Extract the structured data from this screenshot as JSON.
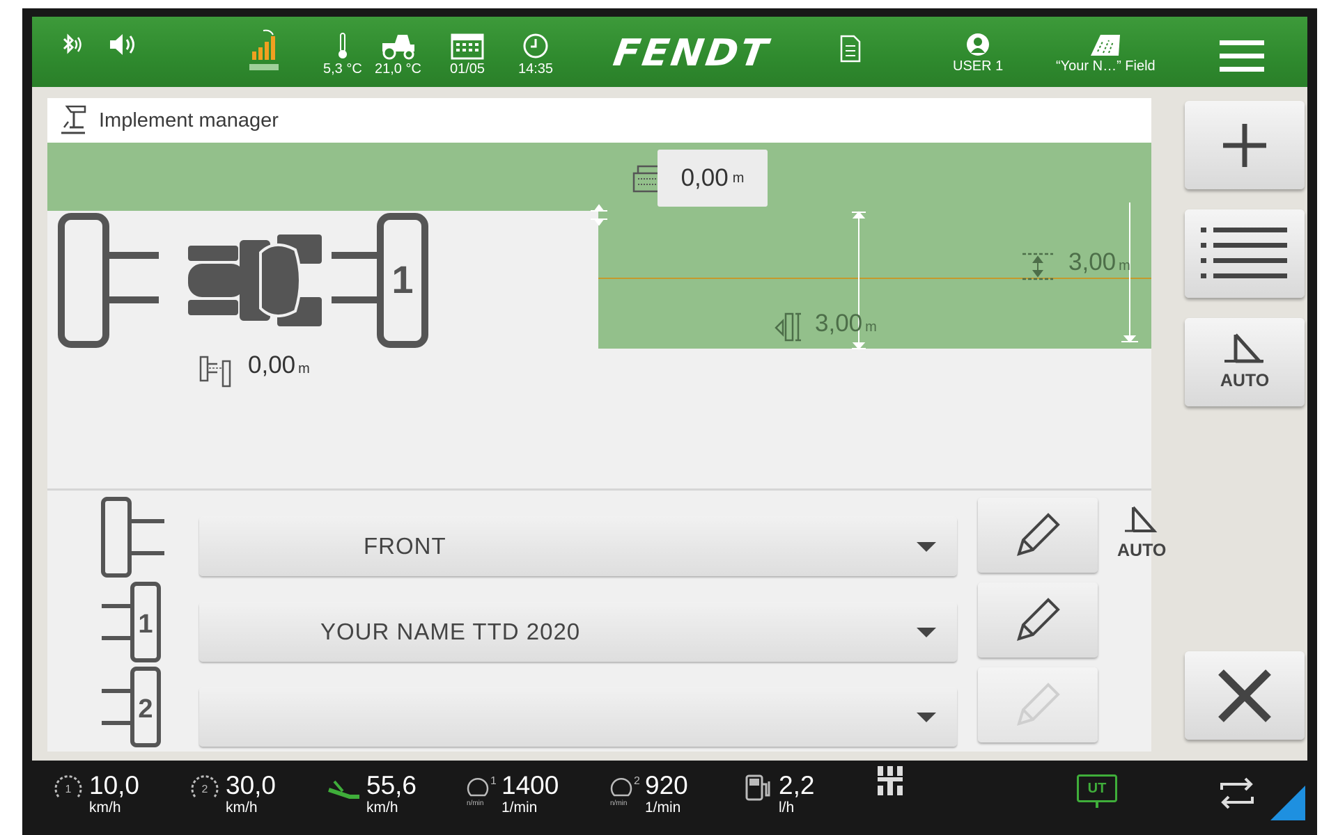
{
  "status_bar": {
    "outside_temp": "5,3 °C",
    "cab_temp": "21,0 °C",
    "date": "01/05",
    "time": "14:35",
    "brand": "FENDT",
    "user": "USER 1",
    "field": "“Your N…” Field"
  },
  "panel": {
    "title": "Implement manager",
    "top_offset_value": "0,00",
    "top_offset_unit": "m",
    "lateral_offset_value": "3,00",
    "lateral_offset_unit": "m",
    "working_width_value": "3,00",
    "working_width_unit": "m",
    "hitch_offset_value": "0,00",
    "hitch_offset_unit": "m",
    "tractor_rear_label": "1"
  },
  "implements": [
    {
      "slot_label": "",
      "name": "FRONT",
      "edit_enabled": true,
      "auto": true,
      "auto_label": "AUTO"
    },
    {
      "slot_label": "1",
      "name": "YOUR NAME TTD 2020",
      "edit_enabled": true,
      "auto": false
    },
    {
      "slot_label": "2",
      "name": "",
      "edit_enabled": false,
      "auto": false
    }
  ],
  "side_buttons": {
    "auto_label": "AUTO"
  },
  "bottom_bar": {
    "cruise1": {
      "value": "10,0",
      "unit": "km/h",
      "badge": "1"
    },
    "cruise2": {
      "value": "30,0",
      "unit": "km/h",
      "badge": "2"
    },
    "speed": {
      "value": "55,6",
      "unit": "km/h"
    },
    "engine_memory1": {
      "value": "1400",
      "unit": "1/min",
      "badge": "1",
      "sub": "n/min"
    },
    "engine_memory2": {
      "value": "920",
      "unit": "1/min",
      "badge": "2",
      "sub": "n/min"
    },
    "fuel": {
      "value": "2,2",
      "unit": "l/h"
    },
    "ut_label": "UT"
  },
  "colors": {
    "topbar_green": "#2f8a2e",
    "field_green": "#93c08b",
    "guide_line": "#c59a2c",
    "ut_green": "#3fae3a"
  }
}
